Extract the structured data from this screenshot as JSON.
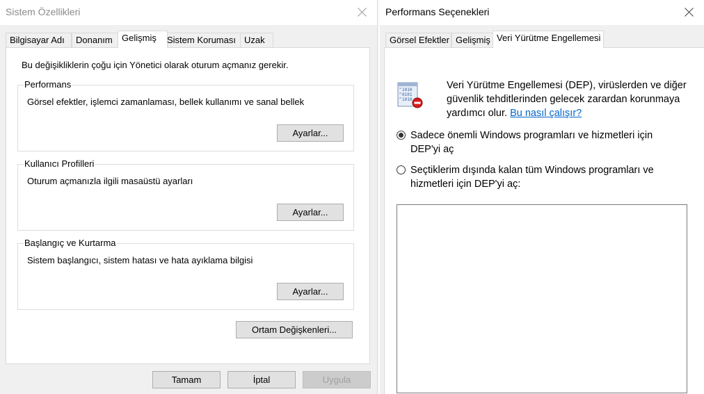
{
  "left_window": {
    "title": "Sistem Özellikleri",
    "tabs": [
      "Bilgisayar Adı",
      "Donanım",
      "Gelişmiş",
      "Sistem Koruması",
      "Uzak"
    ],
    "active_tab": "Gelişmiş",
    "admin_note": "Bu değişikliklerin çoğu için Yönetici olarak oturum açmanız gerekir.",
    "performance": {
      "legend": "Performans",
      "description": "Görsel efektler, işlemci zamanlaması, bellek kullanımı ve sanal bellek",
      "button": "Ayarlar..."
    },
    "user_profiles": {
      "legend": "Kullanıcı Profilleri",
      "description": "Oturum açmanızla ilgili masaüstü ayarları",
      "button": "Ayarlar..."
    },
    "startup_recovery": {
      "legend": "Başlangıç ve Kurtarma",
      "description": "Sistem başlangıcı, sistem hatası ve hata ayıklama bilgisi",
      "button": "Ayarlar..."
    },
    "env_button": "Ortam Değişkenleri...",
    "ok_button": "Tamam",
    "cancel_button": "İptal",
    "apply_button": "Uygula",
    "apply_enabled": false
  },
  "right_window": {
    "title": "Performans Seçenekleri",
    "tabs": [
      "Görsel Efektler",
      "Gelişmiş",
      "Veri Yürütme Engellemesi"
    ],
    "active_tab": "Veri Yürütme Engellemesi",
    "dep_icon": "dep-shield-binary-icon",
    "dep_description": "Veri Yürütme Engellemesi (DEP), virüslerden ve diğer güvenlik tehditlerinden gelecek zarardan korunmaya yardımcı olur.",
    "dep_link": "Bu nasıl çalışır?",
    "option_essential": "Sadece önemli Windows programları ve hizmetleri için DEP'yi aç",
    "option_all_except": "Seçtiklerim dışında kalan tüm Windows programları ve hizmetleri için DEP'yi aç:",
    "selected_option": "option_essential",
    "exception_list": []
  },
  "colors": {
    "dialog_bg": "#f0f0f0",
    "panel_bg": "#ffffff",
    "link": "#0066cc",
    "disabled_text": "#a0a0a0"
  }
}
